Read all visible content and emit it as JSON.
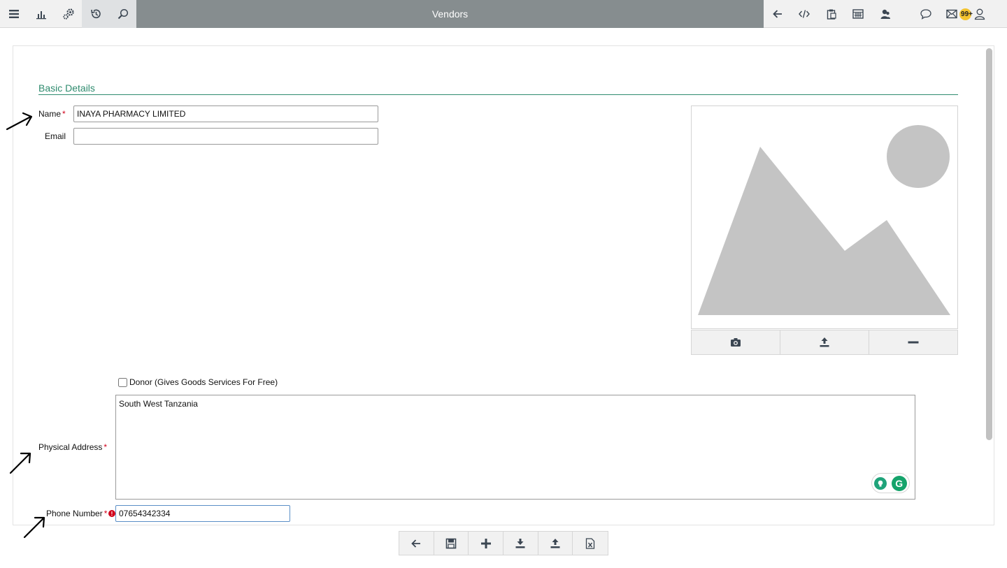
{
  "header": {
    "title": "Vendors",
    "notification_count": "99+",
    "left_icons": [
      "menu-icon",
      "bar-chart-icon",
      "settings-gears-icon",
      "history-icon",
      "search-icon"
    ],
    "right_icons": [
      "back-arrow-icon",
      "code-icon",
      "clipboard-icon",
      "keyboard-icon",
      "users-icon",
      "chat-icon",
      "mail-icon",
      "user-icon"
    ]
  },
  "form": {
    "section_title": "Basic Details",
    "required_mark": "*",
    "name": {
      "label": "Name",
      "value": "INAYA PHARMACY LIMITED"
    },
    "email": {
      "label": "Email",
      "value": ""
    },
    "donor": {
      "label": "Donor (Gives Goods Services For Free)",
      "checked": false
    },
    "physical_address": {
      "label": "Physical Address",
      "value": "South West Tanzania"
    },
    "phone": {
      "label": "Phone Number",
      "value": "07654342334",
      "error_icon": "!"
    }
  },
  "image": {
    "actions": [
      "camera-icon",
      "upload-icon",
      "remove-icon"
    ]
  },
  "toolbar": {
    "actions": [
      "back-icon",
      "save-icon",
      "add-icon",
      "download-icon",
      "upload-icon",
      "excel-icon"
    ]
  },
  "colors": {
    "accent": "#2e8b6e",
    "title_bar": "#868d8f",
    "required": "#d0021b",
    "badge": "#f4c430"
  }
}
